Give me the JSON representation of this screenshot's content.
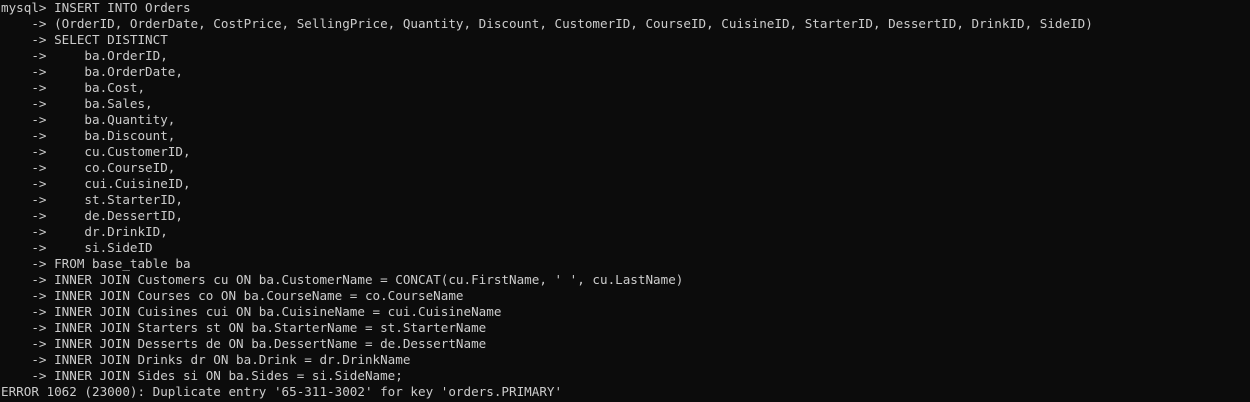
{
  "terminal": {
    "lines": [
      "mysql> INSERT INTO Orders",
      "    -> (OrderID, OrderDate, CostPrice, SellingPrice, Quantity, Discount, CustomerID, CourseID, CuisineID, StarterID, DessertID, DrinkID, SideID)",
      "    -> SELECT DISTINCT",
      "    ->     ba.OrderID,",
      "    ->     ba.OrderDate,",
      "    ->     ba.Cost,",
      "    ->     ba.Sales,",
      "    ->     ba.Quantity,",
      "    ->     ba.Discount,",
      "    ->     cu.CustomerID,",
      "    ->     co.CourseID,",
      "    ->     cui.CuisineID,",
      "    ->     st.StarterID,",
      "    ->     de.DessertID,",
      "    ->     dr.DrinkID,",
      "    ->     si.SideID",
      "    -> FROM base_table ba",
      "    -> INNER JOIN Customers cu ON ba.CustomerName = CONCAT(cu.FirstName, ' ', cu.LastName)",
      "    -> INNER JOIN Courses co ON ba.CourseName = co.CourseName",
      "    -> INNER JOIN Cuisines cui ON ba.CuisineName = cui.CuisineName",
      "    -> INNER JOIN Starters st ON ba.StarterName = st.StarterName",
      "    -> INNER JOIN Desserts de ON ba.DessertName = de.DessertName",
      "    -> INNER JOIN Drinks dr ON ba.Drink = dr.DrinkName",
      "    -> INNER JOIN Sides si ON ba.Sides = si.SideName;",
      "ERROR 1062 (23000): Duplicate entry '65-311-3002' for key 'orders.PRIMARY'"
    ],
    "colors": {
      "background": "#0c0c0c",
      "foreground": "#cccccc"
    }
  }
}
